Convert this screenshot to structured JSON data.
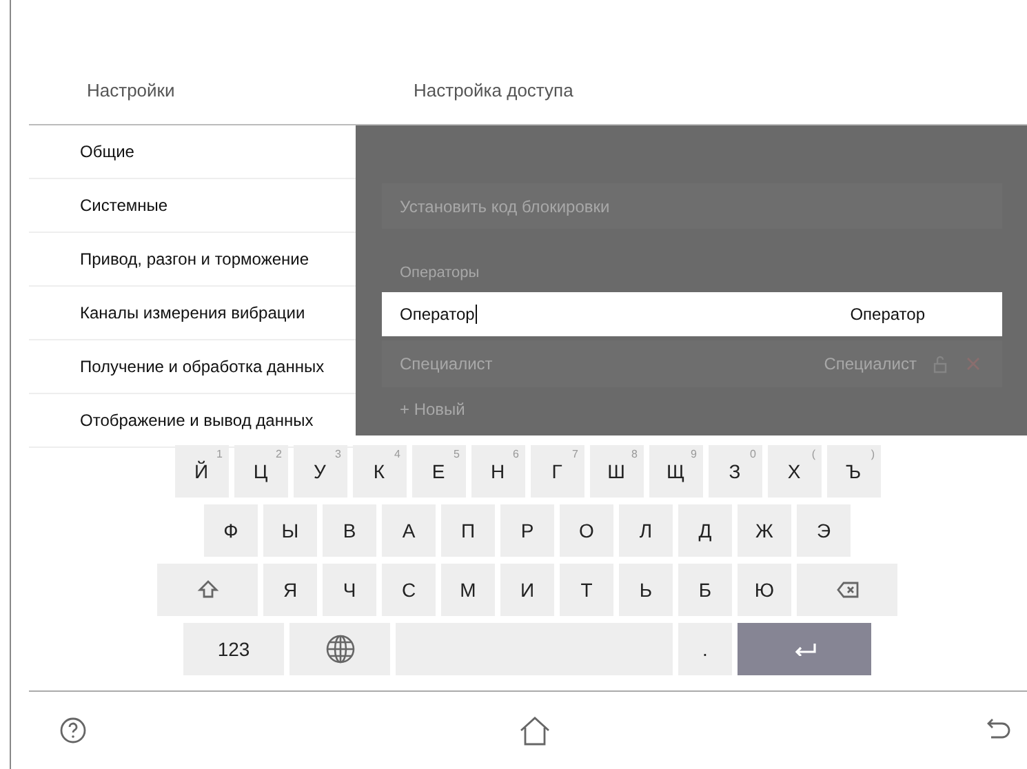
{
  "header": {
    "left_title": "Настройки",
    "right_title": "Настройка доступа"
  },
  "sidebar": {
    "items": [
      {
        "label": "Общие"
      },
      {
        "label": "Системные"
      },
      {
        "label": "Привод, разгон и торможение"
      },
      {
        "label": "Каналы измерения вибрации"
      },
      {
        "label": "Получение и обработка данных"
      },
      {
        "label": "Отображение и вывод данных"
      }
    ]
  },
  "access": {
    "lock_code_button": "Установить код блокировки",
    "operators_label": "Операторы",
    "operators": [
      {
        "name": "Оператор",
        "role": "Оператор",
        "editing": true
      },
      {
        "name": "Специалист",
        "role": "Специалист",
        "editing": false
      }
    ],
    "add_button": "+ Новый"
  },
  "keyboard": {
    "rows": [
      {
        "keys": [
          {
            "kind": "letter",
            "label": "Й",
            "hint": "1"
          },
          {
            "kind": "letter",
            "label": "Ц",
            "hint": "2"
          },
          {
            "kind": "letter",
            "label": "У",
            "hint": "3"
          },
          {
            "kind": "letter",
            "label": "К",
            "hint": "4"
          },
          {
            "kind": "letter",
            "label": "Е",
            "hint": "5"
          },
          {
            "kind": "letter",
            "label": "Н",
            "hint": "6"
          },
          {
            "kind": "letter",
            "label": "Г",
            "hint": "7"
          },
          {
            "kind": "letter",
            "label": "Ш",
            "hint": "8"
          },
          {
            "kind": "letter",
            "label": "Щ",
            "hint": "9"
          },
          {
            "kind": "letter",
            "label": "З",
            "hint": "0"
          },
          {
            "kind": "letter",
            "label": "Х",
            "hint": "("
          },
          {
            "kind": "letter",
            "label": "Ъ",
            "hint": ")"
          }
        ]
      },
      {
        "keys": [
          {
            "kind": "letter",
            "label": "Ф"
          },
          {
            "kind": "letter",
            "label": "Ы"
          },
          {
            "kind": "letter",
            "label": "В"
          },
          {
            "kind": "letter",
            "label": "А"
          },
          {
            "kind": "letter",
            "label": "П"
          },
          {
            "kind": "letter",
            "label": "Р"
          },
          {
            "kind": "letter",
            "label": "О"
          },
          {
            "kind": "letter",
            "label": "Л"
          },
          {
            "kind": "letter",
            "label": "Д"
          },
          {
            "kind": "letter",
            "label": "Ж"
          },
          {
            "kind": "letter",
            "label": "Э"
          }
        ]
      },
      {
        "keys": [
          {
            "kind": "shift"
          },
          {
            "kind": "letter",
            "label": "Я"
          },
          {
            "kind": "letter",
            "label": "Ч"
          },
          {
            "kind": "letter",
            "label": "С"
          },
          {
            "kind": "letter",
            "label": "М"
          },
          {
            "kind": "letter",
            "label": "И"
          },
          {
            "kind": "letter",
            "label": "Т"
          },
          {
            "kind": "letter",
            "label": "Ь"
          },
          {
            "kind": "letter",
            "label": "Б"
          },
          {
            "kind": "letter",
            "label": "Ю"
          },
          {
            "kind": "backspace"
          }
        ]
      },
      {
        "keys": [
          {
            "kind": "mode",
            "label": "123"
          },
          {
            "kind": "globe"
          },
          {
            "kind": "space"
          },
          {
            "kind": "period",
            "label": "."
          },
          {
            "kind": "enter"
          }
        ]
      }
    ]
  }
}
